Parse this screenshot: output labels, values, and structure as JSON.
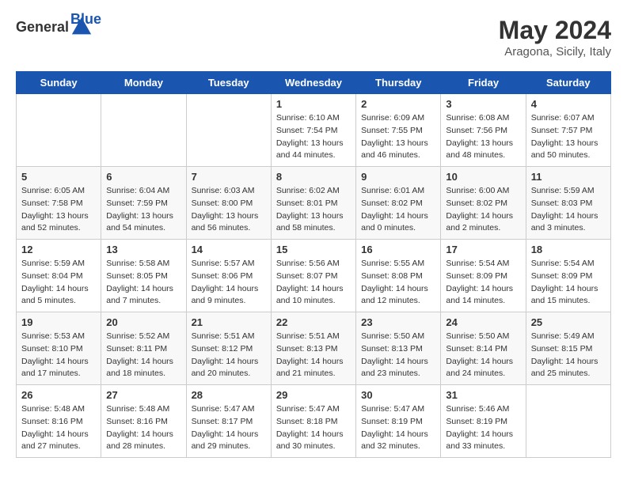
{
  "header": {
    "logo_general": "General",
    "logo_blue": "Blue",
    "month": "May 2024",
    "location": "Aragona, Sicily, Italy"
  },
  "days_of_week": [
    "Sunday",
    "Monday",
    "Tuesday",
    "Wednesday",
    "Thursday",
    "Friday",
    "Saturday"
  ],
  "weeks": [
    [
      {
        "day": "",
        "info": ""
      },
      {
        "day": "",
        "info": ""
      },
      {
        "day": "",
        "info": ""
      },
      {
        "day": "1",
        "info": "Sunrise: 6:10 AM\nSunset: 7:54 PM\nDaylight: 13 hours\nand 44 minutes."
      },
      {
        "day": "2",
        "info": "Sunrise: 6:09 AM\nSunset: 7:55 PM\nDaylight: 13 hours\nand 46 minutes."
      },
      {
        "day": "3",
        "info": "Sunrise: 6:08 AM\nSunset: 7:56 PM\nDaylight: 13 hours\nand 48 minutes."
      },
      {
        "day": "4",
        "info": "Sunrise: 6:07 AM\nSunset: 7:57 PM\nDaylight: 13 hours\nand 50 minutes."
      }
    ],
    [
      {
        "day": "5",
        "info": "Sunrise: 6:05 AM\nSunset: 7:58 PM\nDaylight: 13 hours\nand 52 minutes."
      },
      {
        "day": "6",
        "info": "Sunrise: 6:04 AM\nSunset: 7:59 PM\nDaylight: 13 hours\nand 54 minutes."
      },
      {
        "day": "7",
        "info": "Sunrise: 6:03 AM\nSunset: 8:00 PM\nDaylight: 13 hours\nand 56 minutes."
      },
      {
        "day": "8",
        "info": "Sunrise: 6:02 AM\nSunset: 8:01 PM\nDaylight: 13 hours\nand 58 minutes."
      },
      {
        "day": "9",
        "info": "Sunrise: 6:01 AM\nSunset: 8:02 PM\nDaylight: 14 hours\nand 0 minutes."
      },
      {
        "day": "10",
        "info": "Sunrise: 6:00 AM\nSunset: 8:02 PM\nDaylight: 14 hours\nand 2 minutes."
      },
      {
        "day": "11",
        "info": "Sunrise: 5:59 AM\nSunset: 8:03 PM\nDaylight: 14 hours\nand 3 minutes."
      }
    ],
    [
      {
        "day": "12",
        "info": "Sunrise: 5:59 AM\nSunset: 8:04 PM\nDaylight: 14 hours\nand 5 minutes."
      },
      {
        "day": "13",
        "info": "Sunrise: 5:58 AM\nSunset: 8:05 PM\nDaylight: 14 hours\nand 7 minutes."
      },
      {
        "day": "14",
        "info": "Sunrise: 5:57 AM\nSunset: 8:06 PM\nDaylight: 14 hours\nand 9 minutes."
      },
      {
        "day": "15",
        "info": "Sunrise: 5:56 AM\nSunset: 8:07 PM\nDaylight: 14 hours\nand 10 minutes."
      },
      {
        "day": "16",
        "info": "Sunrise: 5:55 AM\nSunset: 8:08 PM\nDaylight: 14 hours\nand 12 minutes."
      },
      {
        "day": "17",
        "info": "Sunrise: 5:54 AM\nSunset: 8:09 PM\nDaylight: 14 hours\nand 14 minutes."
      },
      {
        "day": "18",
        "info": "Sunrise: 5:54 AM\nSunset: 8:09 PM\nDaylight: 14 hours\nand 15 minutes."
      }
    ],
    [
      {
        "day": "19",
        "info": "Sunrise: 5:53 AM\nSunset: 8:10 PM\nDaylight: 14 hours\nand 17 minutes."
      },
      {
        "day": "20",
        "info": "Sunrise: 5:52 AM\nSunset: 8:11 PM\nDaylight: 14 hours\nand 18 minutes."
      },
      {
        "day": "21",
        "info": "Sunrise: 5:51 AM\nSunset: 8:12 PM\nDaylight: 14 hours\nand 20 minutes."
      },
      {
        "day": "22",
        "info": "Sunrise: 5:51 AM\nSunset: 8:13 PM\nDaylight: 14 hours\nand 21 minutes."
      },
      {
        "day": "23",
        "info": "Sunrise: 5:50 AM\nSunset: 8:13 PM\nDaylight: 14 hours\nand 23 minutes."
      },
      {
        "day": "24",
        "info": "Sunrise: 5:50 AM\nSunset: 8:14 PM\nDaylight: 14 hours\nand 24 minutes."
      },
      {
        "day": "25",
        "info": "Sunrise: 5:49 AM\nSunset: 8:15 PM\nDaylight: 14 hours\nand 25 minutes."
      }
    ],
    [
      {
        "day": "26",
        "info": "Sunrise: 5:48 AM\nSunset: 8:16 PM\nDaylight: 14 hours\nand 27 minutes."
      },
      {
        "day": "27",
        "info": "Sunrise: 5:48 AM\nSunset: 8:16 PM\nDaylight: 14 hours\nand 28 minutes."
      },
      {
        "day": "28",
        "info": "Sunrise: 5:47 AM\nSunset: 8:17 PM\nDaylight: 14 hours\nand 29 minutes."
      },
      {
        "day": "29",
        "info": "Sunrise: 5:47 AM\nSunset: 8:18 PM\nDaylight: 14 hours\nand 30 minutes."
      },
      {
        "day": "30",
        "info": "Sunrise: 5:47 AM\nSunset: 8:19 PM\nDaylight: 14 hours\nand 32 minutes."
      },
      {
        "day": "31",
        "info": "Sunrise: 5:46 AM\nSunset: 8:19 PM\nDaylight: 14 hours\nand 33 minutes."
      },
      {
        "day": "",
        "info": ""
      }
    ]
  ]
}
